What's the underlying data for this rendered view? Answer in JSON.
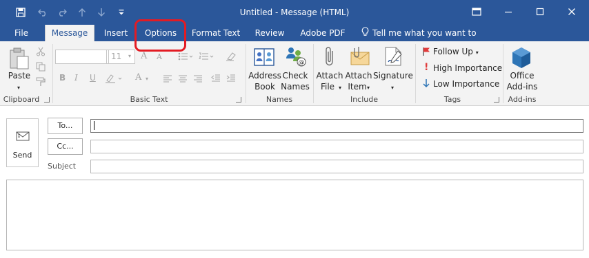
{
  "window": {
    "title": "Untitled  -  Message (HTML)",
    "quick_access": {
      "save": "save-icon",
      "undo": "undo-icon",
      "redo": "redo-icon",
      "up": "up-arrow-icon",
      "down": "down-arrow-icon",
      "customize": "customize-icon"
    },
    "controls": {
      "ribbon_display": "ribbon-display-icon",
      "minimize": "minimize-icon",
      "maximize": "maximize-icon",
      "close": "close-icon"
    }
  },
  "tabs": [
    {
      "label": "File"
    },
    {
      "label": "Message"
    },
    {
      "label": "Insert"
    },
    {
      "label": "Options"
    },
    {
      "label": "Format Text"
    },
    {
      "label": "Review"
    },
    {
      "label": "Adobe PDF"
    }
  ],
  "active_tab": "Message",
  "tell_me": "Tell me what you want to do...",
  "ribbon": {
    "clipboard": {
      "group_label": "Clipboard",
      "paste_label": "Paste"
    },
    "basic_text": {
      "group_label": "Basic Text",
      "font_name": "",
      "font_size": "11",
      "bold": "B",
      "italic": "I",
      "underline": "U",
      "grow": "A",
      "shrink": "A",
      "color": "A"
    },
    "names": {
      "group_label": "Names",
      "address_book_line1": "Address",
      "address_book_line2": "Book",
      "check_names_line1": "Check",
      "check_names_line2": "Names"
    },
    "include": {
      "group_label": "Include",
      "attach_file_line1": "Attach",
      "attach_file_line2": "File",
      "attach_item_line1": "Attach",
      "attach_item_line2": "Item",
      "signature_label": "Signature"
    },
    "tags": {
      "group_label": "Tags",
      "follow_up": "Follow Up",
      "high_importance": "High Importance",
      "low_importance": "Low Importance"
    },
    "addins": {
      "group_label": "Add-ins",
      "office_addins_line1": "Office",
      "office_addins_line2": "Add-ins"
    }
  },
  "compose": {
    "send_label": "Send",
    "to_label": "To...",
    "cc_label": "Cc...",
    "subject_label": "Subject",
    "to_value": "",
    "cc_value": "",
    "subject_value": ""
  },
  "colors": {
    "accent": "#2b579a",
    "highlight_ring": "#e31b23",
    "ribbon_bg": "#f3f3f3"
  }
}
